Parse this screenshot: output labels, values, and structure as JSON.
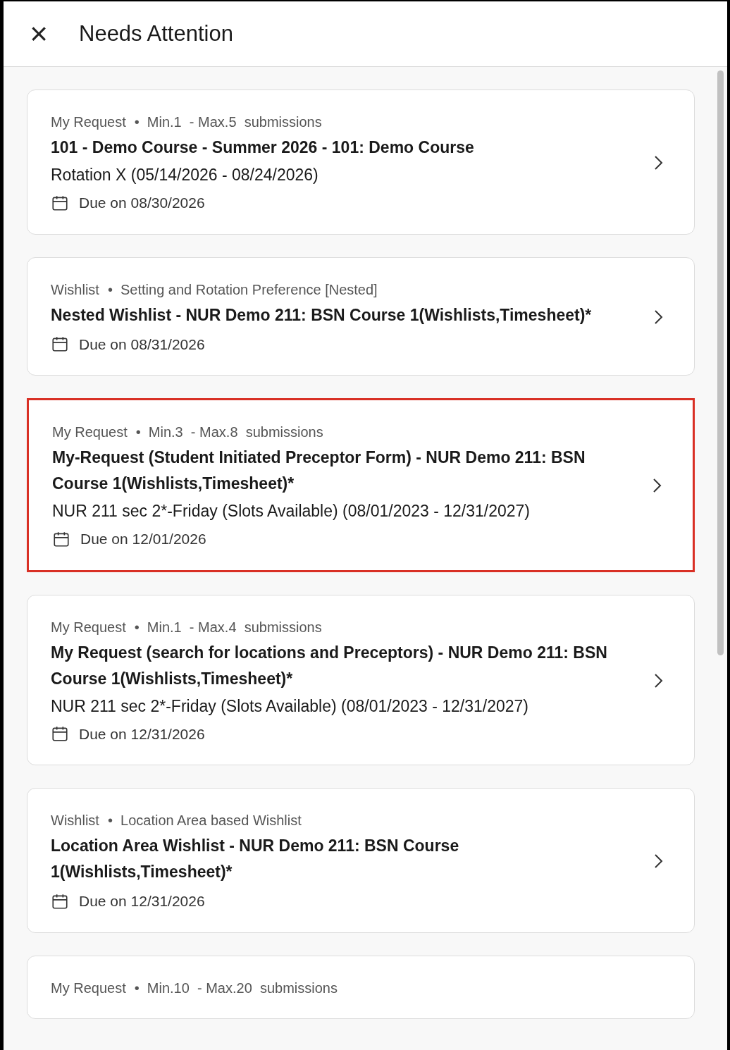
{
  "header": {
    "close": "×",
    "title": "Needs Attention"
  },
  "cards": [
    {
      "type": "My Request",
      "meta": "•  Min.1  - Max.5  submissions",
      "title": "101 - Demo Course - Summer 2026 - 101: Demo Course",
      "subtitle": "Rotation X (05/14/2026 - 08/24/2026)",
      "due": "Due on 08/30/2026",
      "selected": false
    },
    {
      "type": "Wishlist",
      "meta": "•  Setting and Rotation Preference [Nested]",
      "title": "Nested Wishlist - NUR Demo 211: BSN Course 1(Wishlists,Timesheet)*",
      "due": "Due on 08/31/2026",
      "selected": false
    },
    {
      "type": "My Request",
      "meta": "•  Min.3  - Max.8  submissions",
      "title": "My-Request (Student Initiated Preceptor Form) - NUR Demo 211: BSN Course 1(Wishlists,Timesheet)*",
      "subtitle": "NUR 211 sec 2*-Friday (Slots Available) (08/01/2023 - 12/31/2027)",
      "due": "Due on 12/01/2026",
      "selected": true
    },
    {
      "type": "My Request",
      "meta": "•  Min.1  - Max.4  submissions",
      "title": "My Request (search for locations and Preceptors) - NUR Demo 211: BSN Course 1(Wishlists,Timesheet)*",
      "subtitle": "NUR 211 sec 2*-Friday (Slots Available) (08/01/2023 - 12/31/2027)",
      "due": "Due on 12/31/2026",
      "selected": false
    },
    {
      "type": "Wishlist",
      "meta": "•  Location Area based Wishlist",
      "title": "Location Area Wishlist - NUR Demo 211: BSN Course 1(Wishlists,Timesheet)*",
      "due": "Due on 12/31/2026",
      "selected": false
    },
    {
      "type": "My Request",
      "meta": "•  Min.10  - Max.20  submissions",
      "selected": false
    }
  ]
}
